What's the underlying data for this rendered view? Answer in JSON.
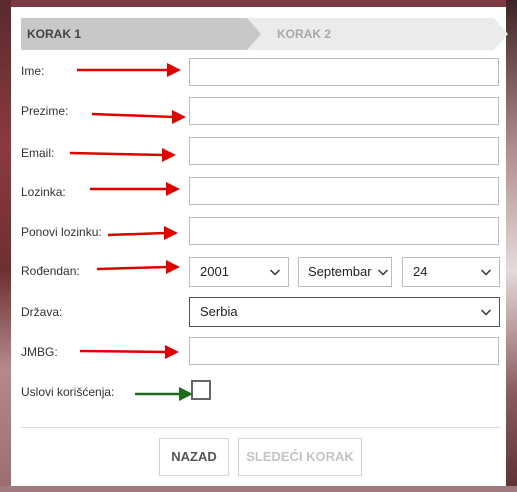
{
  "steps": {
    "step1": "KORAK 1",
    "step2": "KORAK 2"
  },
  "form": {
    "name_label": "Ime:",
    "surname_label": "Prezime:",
    "email_label": "Email:",
    "password_label": "Lozinka:",
    "repeat_password_label": "Ponovi lozinku:",
    "birthday_label": "Rođendan:",
    "birthday_year": "2001",
    "birthday_month": "Septembar",
    "birthday_day": "24",
    "country_label": "Država:",
    "country_value": "Serbia",
    "jmbg_label": "JMBG:",
    "terms_label": "Uslovi korišćenja:"
  },
  "buttons": {
    "back": "NAZAD",
    "next": "SLEDEĆI KORAK"
  },
  "colors": {
    "arrow_red": "#e00000",
    "arrow_green": "#1e6b1e",
    "step_active": "#c8c8c8",
    "step_inactive": "#ebebeb"
  },
  "icons": {
    "select_chevron": "chevron-down-icon",
    "annotation_arrow": "arrow-right-icon"
  }
}
